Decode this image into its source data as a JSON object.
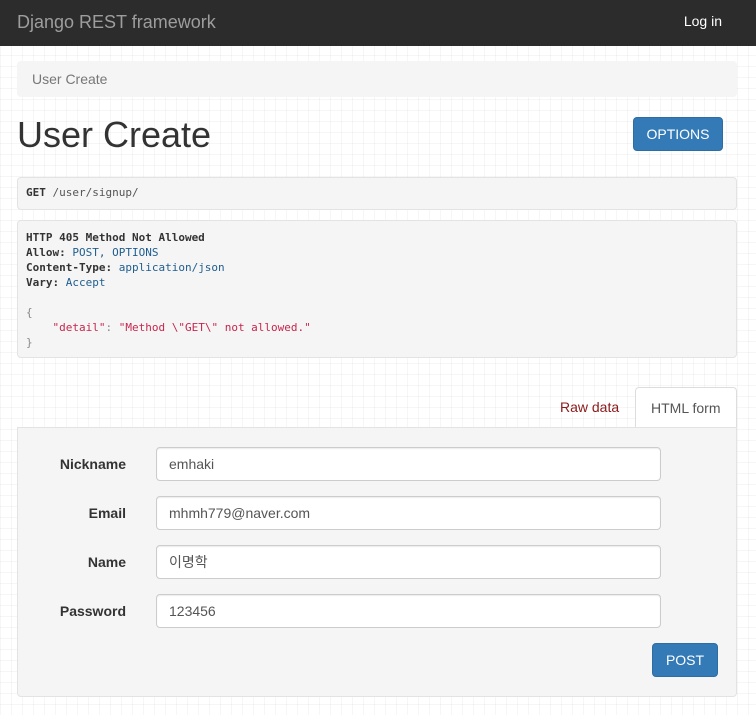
{
  "navbar": {
    "brand": "Django REST framework",
    "login_label": "Log in"
  },
  "breadcrumb": {
    "current": "User Create"
  },
  "page": {
    "title": "User Create",
    "options_label": "OPTIONS"
  },
  "request": {
    "method": "GET",
    "path": "/user/signup/"
  },
  "response": {
    "status": "HTTP 405 Method Not Allowed",
    "headers": [
      {
        "name": "Allow:",
        "value": "POST, OPTIONS"
      },
      {
        "name": "Content-Type:",
        "value": "application/json"
      },
      {
        "name": "Vary:",
        "value": "Accept"
      }
    ],
    "body_open": "{",
    "body_key": "\"detail\"",
    "body_colon": ": ",
    "body_value": "\"Method \\\"GET\\\" not allowed.\"",
    "body_close": "}"
  },
  "tabs": {
    "raw_label": "Raw data",
    "html_label": "HTML form"
  },
  "form": {
    "fields": [
      {
        "label": "Nickname",
        "value": "emhaki"
      },
      {
        "label": "Email",
        "value": "mhmh779@naver.com"
      },
      {
        "label": "Name",
        "value": "이명학"
      },
      {
        "label": "Password",
        "value": "123456"
      }
    ],
    "submit_label": "POST"
  },
  "colors": {
    "navbar": "#2c2c2c",
    "primary": "#337ab7",
    "link_dark_red": "#8b1a1a"
  }
}
